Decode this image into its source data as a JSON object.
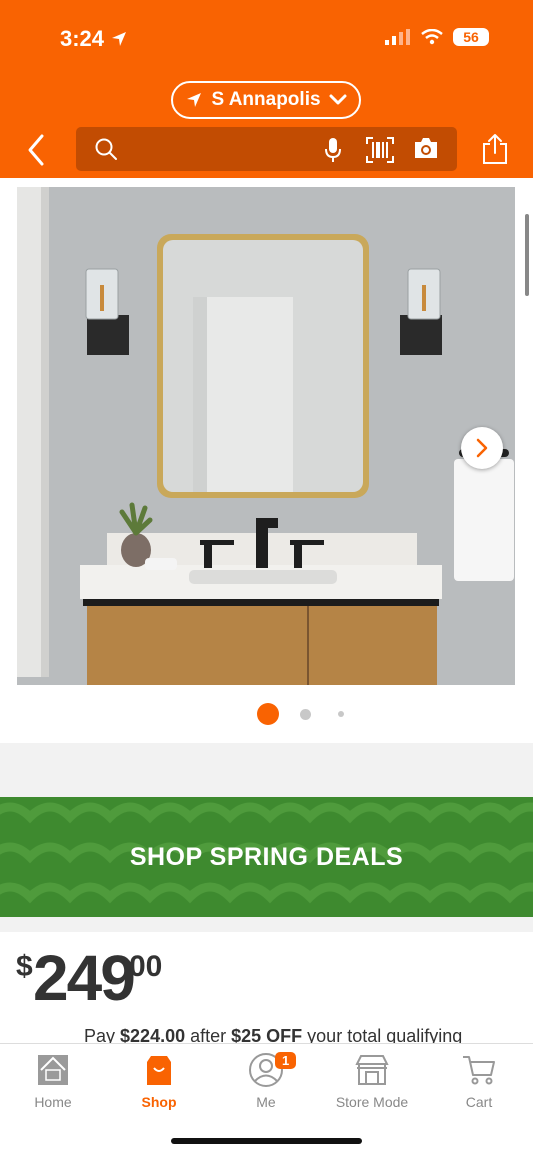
{
  "status_bar": {
    "time": "3:24",
    "battery": "56"
  },
  "header": {
    "location": "S Annapolis",
    "colors": {
      "brand": "#f96302",
      "search_bg": "#c24c02"
    },
    "icons": [
      "back-icon",
      "search-icon",
      "mic-icon",
      "barcode-icon",
      "camera-icon",
      "share-icon"
    ]
  },
  "gallery": {
    "image_count": 3,
    "active_index": 0
  },
  "promo": {
    "text": "SHOP SPRING DEALS",
    "color": "#3e8a2f"
  },
  "price": {
    "currency": "$",
    "dollars": "249",
    "cents": "00"
  },
  "promo_line": {
    "pre": "Pay ",
    "amount": "$224.00",
    "mid": " after ",
    "discount": "$25 OFF",
    "post": " your total qualifying"
  },
  "tabs": [
    {
      "label": "Home",
      "icon": "home-depot-logo-icon",
      "active": false
    },
    {
      "label": "Shop",
      "icon": "shopping-bag-icon",
      "active": true
    },
    {
      "label": "Me",
      "icon": "user-icon",
      "active": false,
      "badge": "1"
    },
    {
      "label": "Store Mode",
      "icon": "store-icon",
      "active": false
    },
    {
      "label": "Cart",
      "icon": "cart-icon",
      "active": false
    }
  ]
}
